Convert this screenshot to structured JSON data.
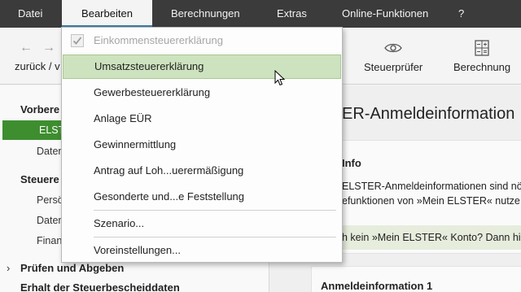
{
  "menubar": {
    "items": [
      "Datei",
      "Bearbeiten",
      "Berechnungen",
      "Extras",
      "Online-Funktionen",
      "?"
    ],
    "active": "Bearbeiten"
  },
  "toolbar": {
    "back_label": "zurück / v",
    "steuerpruefer_label": "Steuerprüfer",
    "berechnung_label": "Berechnung"
  },
  "sidebar": {
    "vorbereitung": "Vorbere",
    "elster": "ELSTER",
    "daten1": "Daten",
    "steuer": "Steuere",
    "person": "Persö",
    "daten2": "Daten",
    "finanz": "Finan",
    "pruefen": "Prüfen und Abgeben",
    "erhalt": "Erhalt der Steuerbescheiddaten"
  },
  "main": {
    "title": "ER-Anmeldeinformation",
    "info_heading": "Info",
    "info_line1": "ELSTER-Anmeldeinformationen sind nöt",
    "info_line2": "efunktionen von »Mein ELSTER« nutze",
    "banner_text": "h kein »Mein ELSTER« Konto? Dann hie",
    "anmelde_title": "Anmeldeinformation 1"
  },
  "dropdown": {
    "items": [
      {
        "label": "Einkommensteuererklärung",
        "state": "disabled-checked"
      },
      {
        "label": "Umsatzsteuererklärung",
        "state": "hover"
      },
      {
        "label": "Gewerbesteuererklärung",
        "state": "normal"
      },
      {
        "label": "Anlage EÜR",
        "state": "normal"
      },
      {
        "label": "Gewinnermittlung",
        "state": "normal"
      },
      {
        "label": "Antrag auf Loh...uerermäßigung",
        "state": "normal"
      },
      {
        "label": "Gesonderte und...e Feststellung",
        "state": "normal"
      },
      {
        "label": "Szenario...",
        "state": "normal"
      },
      {
        "label": "Voreinstellungen...",
        "state": "normal"
      }
    ]
  },
  "colors": {
    "menubar_bg": "#3b3b3b",
    "selected_green": "#3e8e2f",
    "hover_green": "#cde3bf"
  }
}
